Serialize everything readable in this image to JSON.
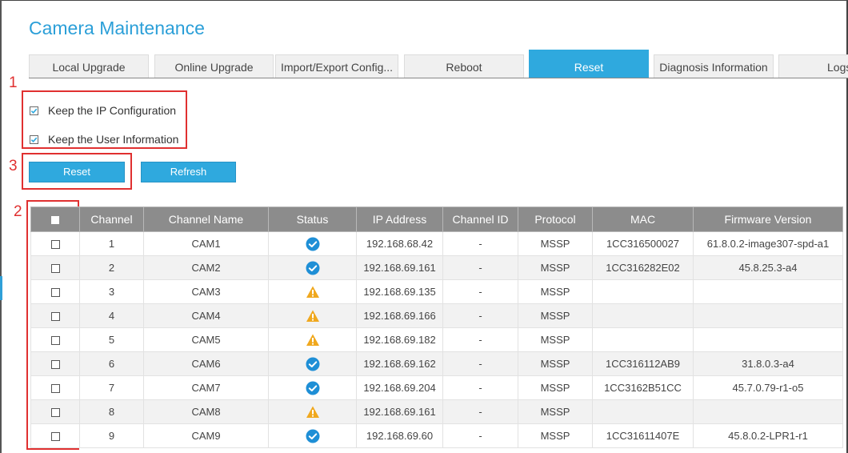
{
  "page": {
    "title": "Camera Maintenance"
  },
  "tabs": [
    {
      "label": "Local Upgrade"
    },
    {
      "label": "Online Upgrade"
    },
    {
      "label": "Import/Export Config..."
    },
    {
      "label": "Reboot"
    },
    {
      "label": "Reset",
      "active": true
    },
    {
      "label": "Diagnosis Information"
    },
    {
      "label": "Logs"
    }
  ],
  "options": {
    "keep_ip": {
      "label": "Keep the IP Configuration",
      "checked": true
    },
    "keep_user": {
      "label": "Keep the User Information",
      "checked": true
    }
  },
  "buttons": {
    "reset": "Reset",
    "refresh": "Refresh"
  },
  "annotations": {
    "one": "1",
    "two": "2",
    "three": "3"
  },
  "colors": {
    "accent": "#2fa9de",
    "annotation": "#e03030",
    "ok": "#1f8fd6",
    "warning": "#f0a81e"
  },
  "table": {
    "columns": [
      "Channel",
      "Channel Name",
      "Status",
      "IP Address",
      "Channel ID",
      "Protocol",
      "MAC",
      "Firmware Version"
    ],
    "rows": [
      {
        "channel": "1",
        "name": "CAM1",
        "status": "check-circle-icon",
        "ip": "192.168.68.42",
        "channel_id": "-",
        "protocol": "MSSP",
        "mac": "1CC316500027",
        "firmware": "61.8.0.2-image307-spd-a1"
      },
      {
        "channel": "2",
        "name": "CAM2",
        "status": "check-circle-icon",
        "ip": "192.168.69.161",
        "channel_id": "-",
        "protocol": "MSSP",
        "mac": "1CC316282E02",
        "firmware": "45.8.25.3-a4"
      },
      {
        "channel": "3",
        "name": "CAM3",
        "status": "warning-triangle-icon",
        "ip": "192.168.69.135",
        "channel_id": "-",
        "protocol": "MSSP",
        "mac": "",
        "firmware": ""
      },
      {
        "channel": "4",
        "name": "CAM4",
        "status": "warning-triangle-icon",
        "ip": "192.168.69.166",
        "channel_id": "-",
        "protocol": "MSSP",
        "mac": "",
        "firmware": ""
      },
      {
        "channel": "5",
        "name": "CAM5",
        "status": "warning-triangle-icon",
        "ip": "192.168.69.182",
        "channel_id": "-",
        "protocol": "MSSP",
        "mac": "",
        "firmware": ""
      },
      {
        "channel": "6",
        "name": "CAM6",
        "status": "check-circle-icon",
        "ip": "192.168.69.162",
        "channel_id": "-",
        "protocol": "MSSP",
        "mac": "1CC316112AB9",
        "firmware": "31.8.0.3-a4"
      },
      {
        "channel": "7",
        "name": "CAM7",
        "status": "check-circle-icon",
        "ip": "192.168.69.204",
        "channel_id": "-",
        "protocol": "MSSP",
        "mac": "1CC3162B51CC",
        "firmware": "45.7.0.79-r1-o5"
      },
      {
        "channel": "8",
        "name": "CAM8",
        "status": "warning-triangle-icon",
        "ip": "192.168.69.161",
        "channel_id": "-",
        "protocol": "MSSP",
        "mac": "",
        "firmware": ""
      },
      {
        "channel": "9",
        "name": "CAM9",
        "status": "check-circle-icon",
        "ip": "192.168.69.60",
        "channel_id": "-",
        "protocol": "MSSP",
        "mac": "1CC31611407E",
        "firmware": "45.8.0.2-LPR1-r1"
      }
    ]
  }
}
